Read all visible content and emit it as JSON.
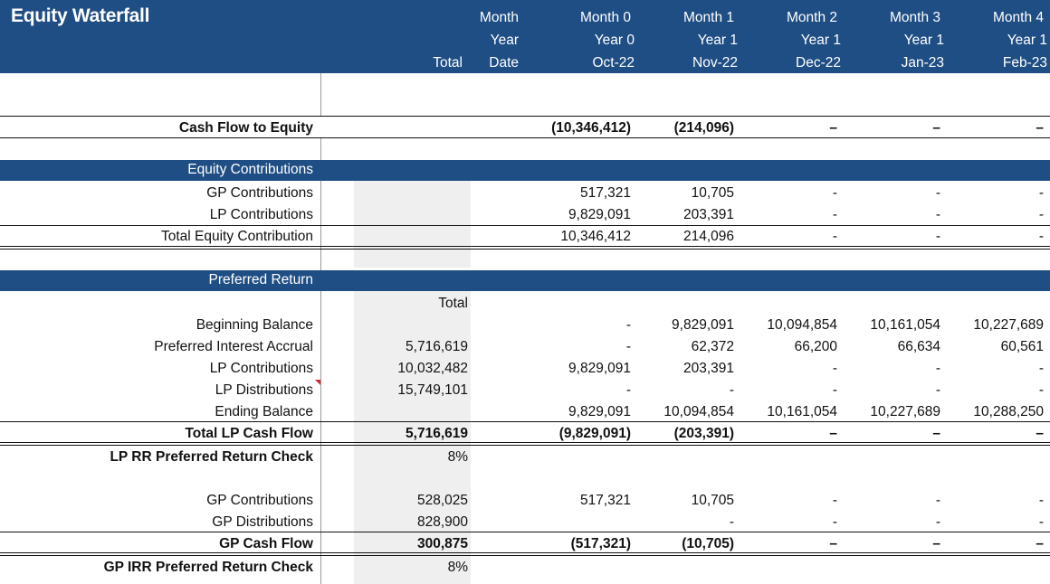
{
  "header": {
    "title": "Equity Waterfall",
    "total_label": "Total",
    "columns": [
      {
        "l1": "Month",
        "l2": "Year",
        "l3": "Date"
      },
      {
        "l1": "Month 0",
        "l2": "Year 0",
        "l3": "Oct-22"
      },
      {
        "l1": "Month 1",
        "l2": "Year 1",
        "l3": "Nov-22"
      },
      {
        "l1": "Month 2",
        "l2": "Year 1",
        "l3": "Dec-22"
      },
      {
        "l1": "Month 3",
        "l2": "Year 1",
        "l3": "Jan-23"
      },
      {
        "l1": "Month 4",
        "l2": "Year 1",
        "l3": "Feb-23"
      }
    ]
  },
  "cash_flow_to_equity": {
    "label": "Cash Flow to Equity",
    "m0": "(10,346,412)",
    "m1": "(214,096)",
    "m2": "–",
    "m3": "–",
    "m4": "–"
  },
  "equity_contributions": {
    "title": "Equity Contributions",
    "gp": {
      "label": "GP Contributions",
      "m0": "517,321",
      "m1": "10,705",
      "m2": "-",
      "m3": "-",
      "m4": "-"
    },
    "lp": {
      "label": "LP Contributions",
      "m0": "9,829,091",
      "m1": "203,391",
      "m2": "-",
      "m3": "-",
      "m4": "-"
    },
    "total": {
      "label": "Total Equity Contribution",
      "m0": "10,346,412",
      "m1": "214,096",
      "m2": "-",
      "m3": "-",
      "m4": "-"
    }
  },
  "preferred_return": {
    "title": "Preferred Return",
    "total_label": "Total",
    "beginning": {
      "label": "Beginning Balance",
      "total": "",
      "m0": "-",
      "m1": "9,829,091",
      "m2": "10,094,854",
      "m3": "10,161,054",
      "m4": "10,227,689"
    },
    "accrual": {
      "label": "Preferred Interest Accrual",
      "total": "5,716,619",
      "m0": "-",
      "m1": "62,372",
      "m2": "66,200",
      "m3": "66,634",
      "m4": "60,561"
    },
    "lp_contrib": {
      "label": "LP Contributions",
      "total": "10,032,482",
      "m0": "9,829,091",
      "m1": "203,391",
      "m2": "-",
      "m3": "-",
      "m4": "-"
    },
    "lp_dist": {
      "label": "LP Distributions",
      "total": "15,749,101",
      "m0": "-",
      "m1": "-",
      "m2": "-",
      "m3": "-",
      "m4": "-"
    },
    "ending": {
      "label": "Ending Balance",
      "total": "",
      "m0": "9,829,091",
      "m1": "10,094,854",
      "m2": "10,161,054",
      "m3": "10,227,689",
      "m4": "10,288,250"
    },
    "lp_cash_flow": {
      "label": "Total LP Cash Flow",
      "total": "5,716,619",
      "m0": "(9,829,091)",
      "m1": "(203,391)",
      "m2": "–",
      "m3": "–",
      "m4": "–"
    },
    "lp_check": {
      "label": "LP RR Preferred Return Check",
      "total": "8%"
    },
    "gp_contrib": {
      "label": "GP Contributions",
      "total": "528,025",
      "m0": "517,321",
      "m1": "10,705",
      "m2": "-",
      "m3": "-",
      "m4": "-"
    },
    "gp_dist": {
      "label": "GP Distributions",
      "total": "828,900",
      "m0": "",
      "m1": "-",
      "m2": "-",
      "m3": "-",
      "m4": "-"
    },
    "gp_cash_flow": {
      "label": "GP Cash Flow",
      "total": "300,875",
      "m0": "(517,321)",
      "m1": "(10,705)",
      "m2": "–",
      "m3": "–",
      "m4": "–"
    },
    "gp_check": {
      "label": "GP IRR Preferred Return Check",
      "total": "8%"
    }
  }
}
